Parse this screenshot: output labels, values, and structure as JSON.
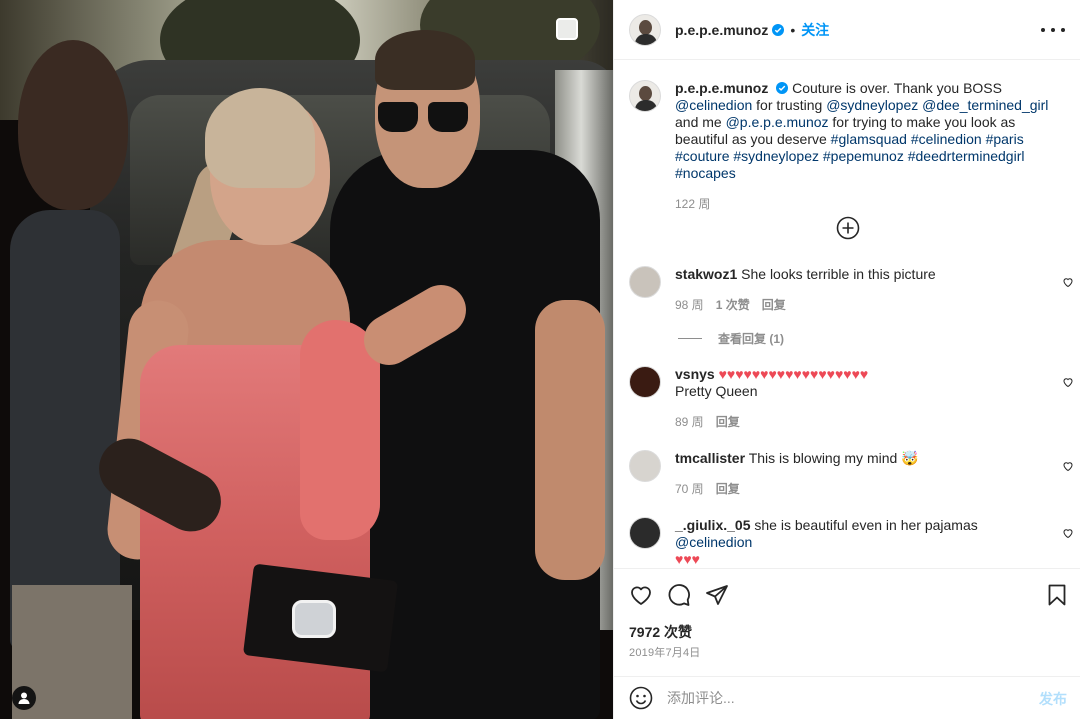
{
  "post": {
    "username": "p.e.p.e.munoz",
    "follow_label": "关注",
    "dot": "•"
  },
  "caption": {
    "username": "p.e.p.e.munoz",
    "parts": [
      {
        "t": "Couture is over. Thank you BOSS ",
        "link": false
      },
      {
        "t": "@celinedion",
        "link": true
      },
      {
        "t": " for trusting ",
        "link": false
      },
      {
        "t": "@sydneylopez",
        "link": true
      },
      {
        "t": " ",
        "link": false
      },
      {
        "t": "@dee_termined_girl",
        "link": true
      },
      {
        "t": " and me ",
        "link": false
      },
      {
        "t": "@p.e.p.e.munoz",
        "link": true
      },
      {
        "t": " for trying to make you look as beautiful as you deserve ",
        "link": false
      },
      {
        "t": "#glamsquad",
        "link": true
      },
      {
        "t": " ",
        "link": false
      },
      {
        "t": "#celinedion",
        "link": true
      },
      {
        "t": " ",
        "link": false
      },
      {
        "t": "#paris",
        "link": true
      },
      {
        "t": " ",
        "link": false
      },
      {
        "t": "#couture",
        "link": true
      },
      {
        "t": " ",
        "link": false
      },
      {
        "t": "#sydneylopez",
        "link": true
      },
      {
        "t": " ",
        "link": false
      },
      {
        "t": "#pepemunoz",
        "link": true
      },
      {
        "t": " ",
        "link": false
      },
      {
        "t": "#deedrterminedgirl",
        "link": true
      },
      {
        "t": " ",
        "link": false
      },
      {
        "t": "#nocapes",
        "link": true
      }
    ],
    "time": "122 周"
  },
  "comments": [
    {
      "username": "stakwoz1",
      "text": "She looks terrible in this picture",
      "time": "98 周",
      "likes": "1 次赞",
      "reply": "回复"
    },
    {
      "username": "vsnys",
      "text": "♥♥♥♥♥♥♥♥♥♥♥♥♥♥♥♥♥♥",
      "text2": "Pretty Queen",
      "time": "89 周",
      "reply": "回复"
    },
    {
      "username": "tmcallister",
      "text": "This is blowing my mind 🤯",
      "time": "70 周",
      "reply": "回复"
    },
    {
      "username": "_.giulix._05",
      "text": "she is beautiful even in her pajamas ",
      "mention": "@celinedion",
      "text2": "♥♥♥"
    }
  ],
  "view_replies": "查看回复 (1)",
  "actions": {
    "likes": "7972 次赞",
    "date": "2019年7月4日"
  },
  "add_comment": {
    "placeholder": "添加评论...",
    "post_label": "发布"
  },
  "colors": {
    "link": "#00376b",
    "accent": "#0095f6",
    "heart": "#ed4956",
    "muted": "#8e8e8e"
  }
}
